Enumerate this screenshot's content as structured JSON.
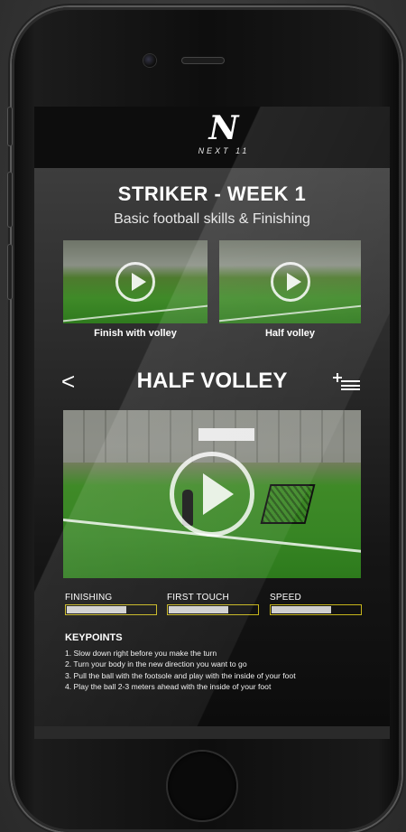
{
  "app": {
    "logo_mark": "N",
    "logo_text": "NEXT 11"
  },
  "program": {
    "title": "STRIKER - WEEK 1",
    "subtitle": "Basic football skills & Finishing"
  },
  "thumbnails": [
    {
      "label": "Finish with volley",
      "icon": "play-icon"
    },
    {
      "label": "Half volley",
      "icon": "play-icon"
    }
  ],
  "exercise": {
    "back_glyph": "<",
    "title": "HALF VOLLEY",
    "add_icon": "add-to-list-icon",
    "video_icon": "play-icon"
  },
  "stats": [
    {
      "label": "FINISHING",
      "level": 0.68
    },
    {
      "label": "FIRST TOUCH",
      "level": 0.68
    },
    {
      "label": "SPEED",
      "level": 0.68
    }
  ],
  "colors": {
    "bar_border": "#c6b51c",
    "bar_fill": "#cfcfcf"
  },
  "keypoints": {
    "title": "KEYPOINTS",
    "items": [
      "1. Slow down right before you make the turn",
      "2. Turn your body in the new direction you want to go",
      "3. Pull the ball with the footsole and play with the inside of your foot",
      "4. Play the ball 2-3 meters ahead with the inside of your foot"
    ]
  }
}
